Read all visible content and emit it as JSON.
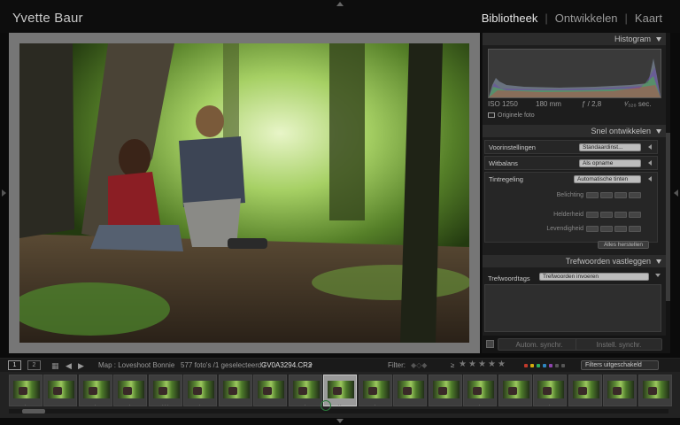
{
  "identity": {
    "name": "Yvette Baur"
  },
  "modules": [
    "Bibliotheek",
    "Ontwikkelen",
    "Kaart"
  ],
  "active_module": "Bibliotheek",
  "panels": {
    "histogram": {
      "title": "Histogram",
      "iso": "ISO 1250",
      "focal": "180 mm",
      "aperture": "ƒ / 2,8",
      "shutter": "¹⁄₃₂₀ sec.",
      "original_photo": "Originele foto"
    },
    "quick_develop": {
      "title": "Snel ontwikkelen",
      "presets_label": "Voorinstellingen",
      "presets_value": "Standaardinst...",
      "wb_label": "Witbalans",
      "wb_value": "Als opname",
      "tone_label": "Tintregeling",
      "tone_value": "Automatische tinten",
      "exposure": "Belichting",
      "clarity": "Helderheid",
      "vibrance": "Levendigheid",
      "reset": "Alles herstellen"
    },
    "keywords": {
      "title": "Trefwoorden vastleggen",
      "label": "Trefwoordtags",
      "value": "Trefwoorden invoeren"
    }
  },
  "sync": {
    "auto": "Autom. synchr.",
    "settings": "Instell. synchr."
  },
  "toolbar": {
    "monitor1": "1",
    "monitor2": "2",
    "folder": "Map : Loveshoot Bonnie",
    "count": "577 foto's /1 geselecteerd /",
    "filename": "GV0A3294.CR2",
    "filter_label": "Filter:",
    "filters_off": "Filters uitgeschakeld"
  },
  "colors": {
    "label_red": "#c0392b",
    "label_yellow": "#d4ac0d",
    "label_green": "#27ae60",
    "label_blue": "#2e86c1",
    "label_purple": "#8e44ad",
    "accent_selected": "#9a9a9a"
  }
}
